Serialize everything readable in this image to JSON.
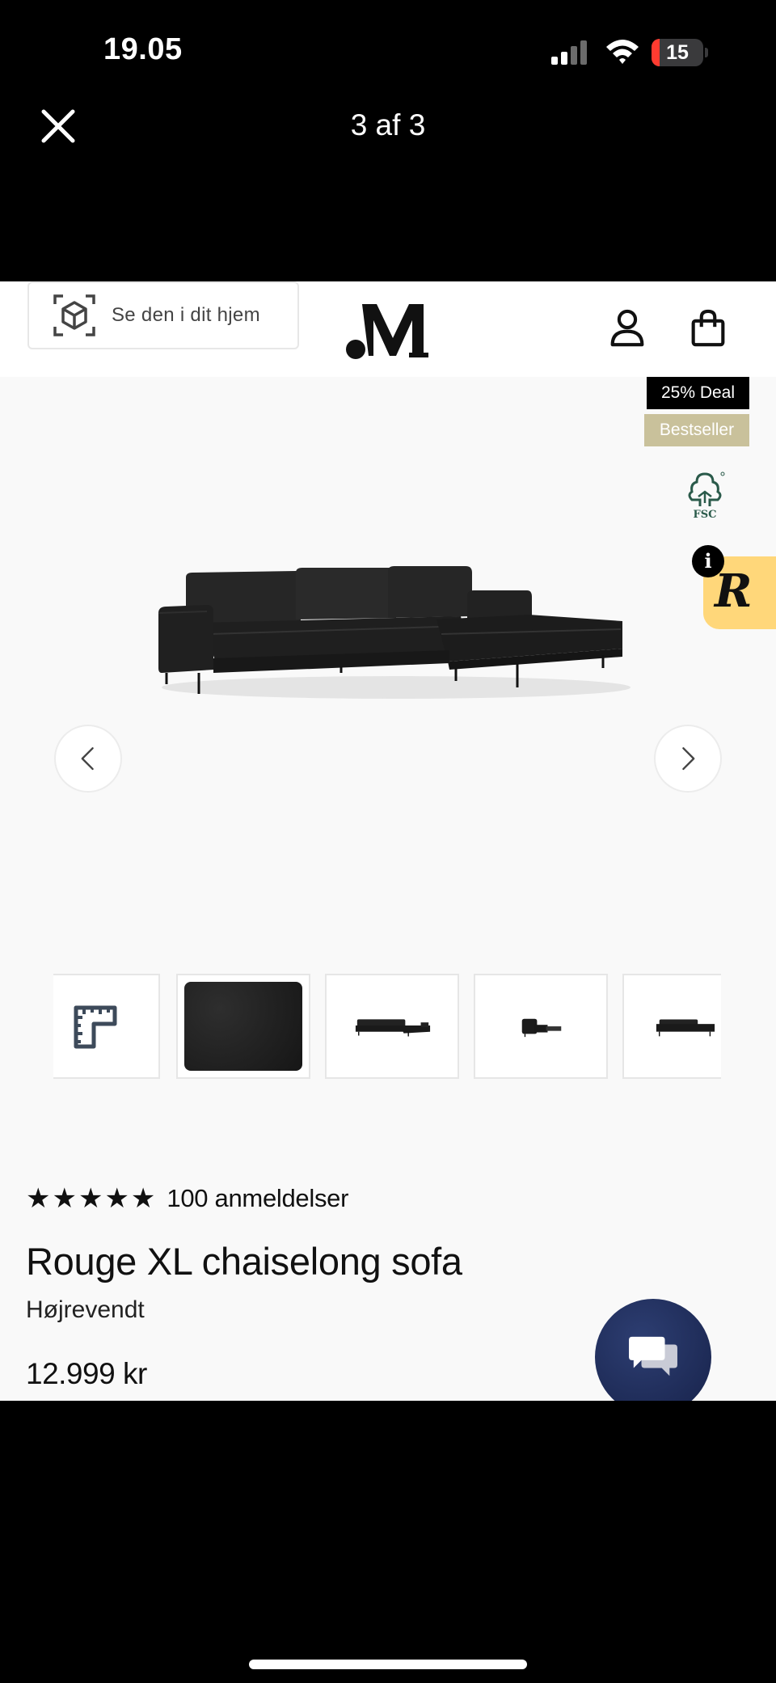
{
  "status_bar": {
    "time": "19.05",
    "battery_level": "15",
    "battery_fraction": 0.15
  },
  "viewer": {
    "counter": "3 af 3",
    "close_icon": "close-icon"
  },
  "header": {
    "menu_icon": "hamburger-menu-icon",
    "search_icon": "search-icon",
    "logo_text": ".M",
    "account_icon": "user-icon",
    "cart_icon": "shopping-bag-icon"
  },
  "ar_button": {
    "label": "Se den i dit hjem",
    "icon": "ar-cube-icon"
  },
  "badges": {
    "deal": "25% Deal",
    "bestseller": "Bestseller"
  },
  "certification": {
    "label": "FSC",
    "icon": "fsc-tree-icon"
  },
  "review_widget": {
    "letter": "R",
    "info_label": "i"
  },
  "gallery": {
    "prev_icon": "chevron-left-icon",
    "next_icon": "chevron-right-icon",
    "thumbnails": [
      {
        "type": "dimensions",
        "icon": "ruler-icon"
      },
      {
        "type": "fabric"
      },
      {
        "type": "sofa-front"
      },
      {
        "type": "sofa-side"
      },
      {
        "type": "sofa-angle"
      }
    ]
  },
  "product": {
    "stars": "★★★★★",
    "rating_fraction": 1.0,
    "review_count": "100 anmeldelser",
    "title": "Rouge XL chaiselong sofa",
    "variant": "Højrevendt",
    "price": "12.999 kr"
  },
  "chat": {
    "icon": "chat-bubbles-icon"
  },
  "colors": {
    "deal_badge_bg": "#000000",
    "bestseller_badge_bg": "#c9c19b",
    "review_tab_bg": "#ffd77a",
    "chat_button_bg": "#1f2b55",
    "page_bg": "#f9f9f9"
  }
}
